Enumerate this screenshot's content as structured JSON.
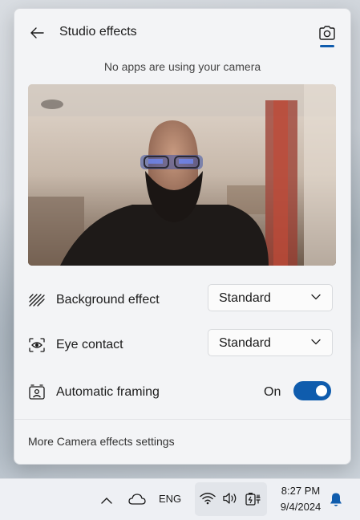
{
  "flyout": {
    "title": "Studio effects",
    "status": "No apps are using your camera",
    "rows": [
      {
        "label": "Background effect",
        "value": "Standard",
        "icon": "background-blur-icon"
      },
      {
        "label": "Eye contact",
        "value": "Standard",
        "icon": "eye-contact-icon"
      },
      {
        "label": "Automatic framing",
        "toggle_label": "On",
        "toggle_on": true,
        "icon": "auto-framing-icon"
      }
    ],
    "footer_link": "More Camera effects settings",
    "accent_color": "#0f5cad"
  },
  "taskbar": {
    "language": "ENG",
    "time": "8:27 PM",
    "date": "9/4/2024"
  }
}
